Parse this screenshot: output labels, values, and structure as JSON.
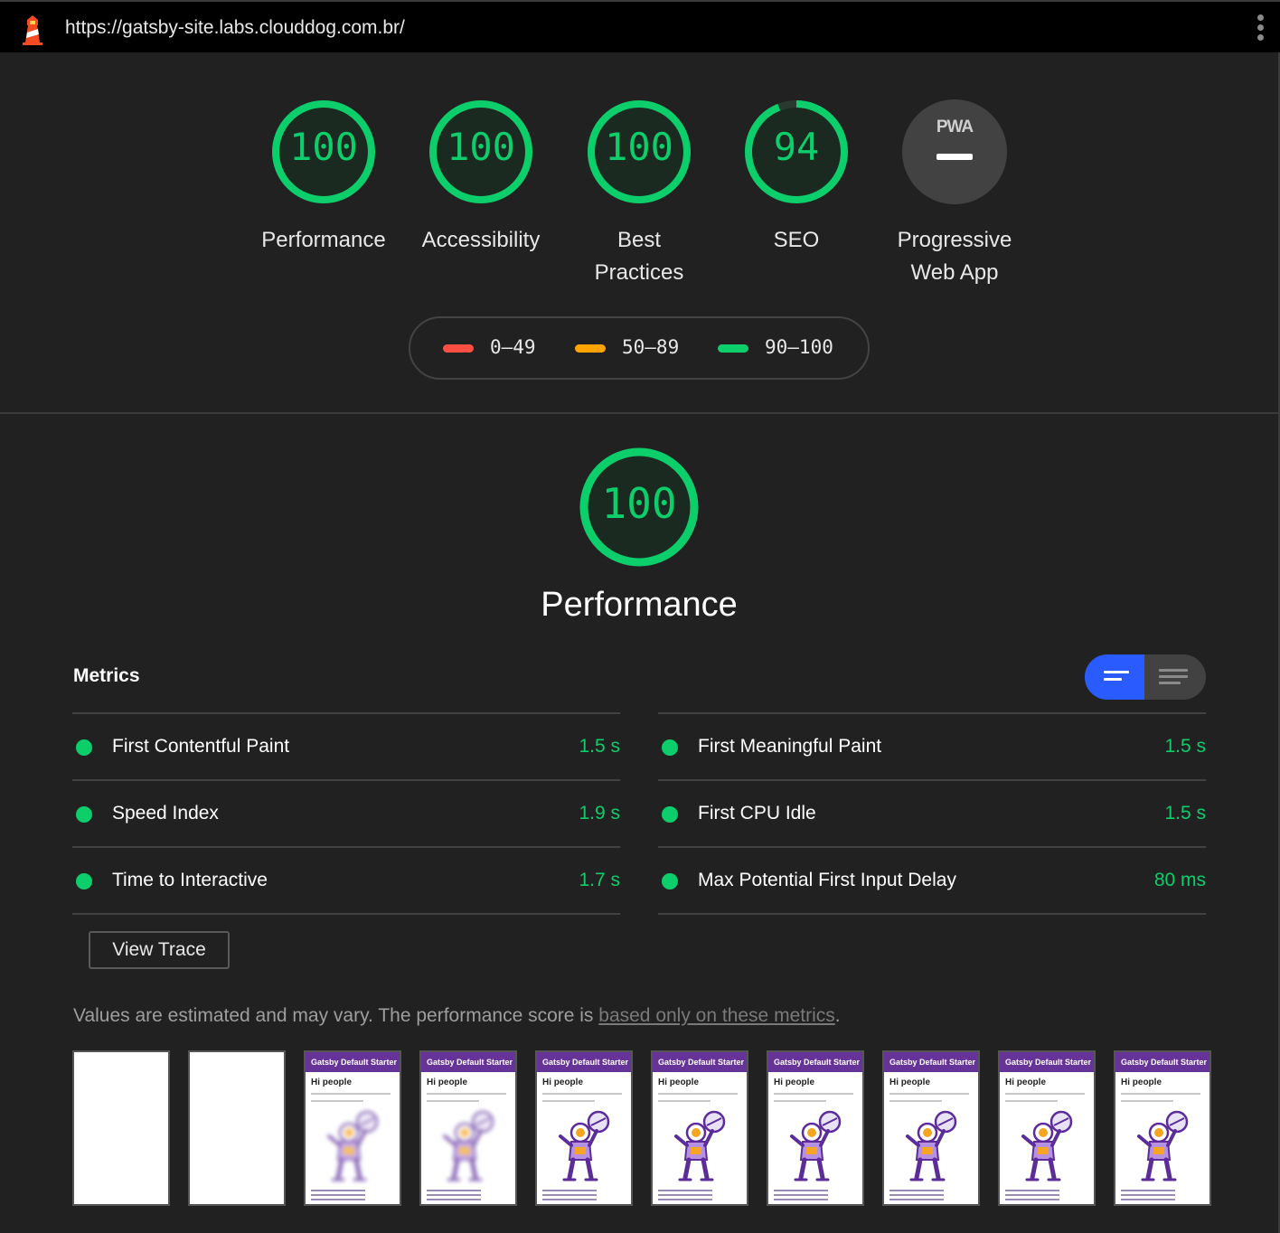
{
  "browser": {
    "url": "https://gatsby-site.labs.clouddog.com.br/",
    "logo_icon": "lighthouse-icon",
    "menu_icon": "kebab-menu-icon"
  },
  "categories": [
    {
      "id": "performance",
      "label": "Performance",
      "score": "100",
      "score_value": 100
    },
    {
      "id": "accessibility",
      "label": "Accessibility",
      "score": "100",
      "score_value": 100
    },
    {
      "id": "best-practices",
      "label_line1": "Best",
      "label_line2": "Practices",
      "score": "100",
      "score_value": 100
    },
    {
      "id": "seo",
      "label": "SEO",
      "score": "94",
      "score_value": 94
    },
    {
      "id": "pwa",
      "label_line1": "Progressive",
      "label_line2": "Web App",
      "badge": "PWA"
    }
  ],
  "legend": [
    {
      "range": "0–49",
      "color": "#ff4e42"
    },
    {
      "range": "50–89",
      "color": "#ffa400"
    },
    {
      "range": "90–100",
      "color": "#0cce6b"
    }
  ],
  "performance": {
    "score": "100",
    "score_value": 100,
    "title": "Performance",
    "metrics_title": "Metrics",
    "metrics_left": [
      {
        "name": "First Contentful Paint",
        "value": "1.5 s"
      },
      {
        "name": "Speed Index",
        "value": "1.9 s"
      },
      {
        "name": "Time to Interactive",
        "value": "1.7 s"
      }
    ],
    "metrics_right": [
      {
        "name": "First Meaningful Paint",
        "value": "1.5 s"
      },
      {
        "name": "First CPU Idle",
        "value": "1.5 s"
      },
      {
        "name": "Max Potential First Input Delay",
        "value": "80 ms"
      }
    ],
    "view_trace_label": "View Trace",
    "note_text": "Values are estimated and may vary. The performance score is ",
    "note_link": "based only on these metrics",
    "note_end": "."
  },
  "filmstrip": {
    "header_text": "Gatsby Default Starter",
    "heading_text": "Hi people",
    "frames": [
      "blank",
      "blank",
      "blurred",
      "blurred",
      "loaded",
      "loaded",
      "loaded",
      "loaded",
      "loaded",
      "loaded"
    ]
  },
  "colors": {
    "pass": "#0cce6b",
    "toggle_active": "#2a5bff",
    "gatsby_purple": "#663399"
  }
}
